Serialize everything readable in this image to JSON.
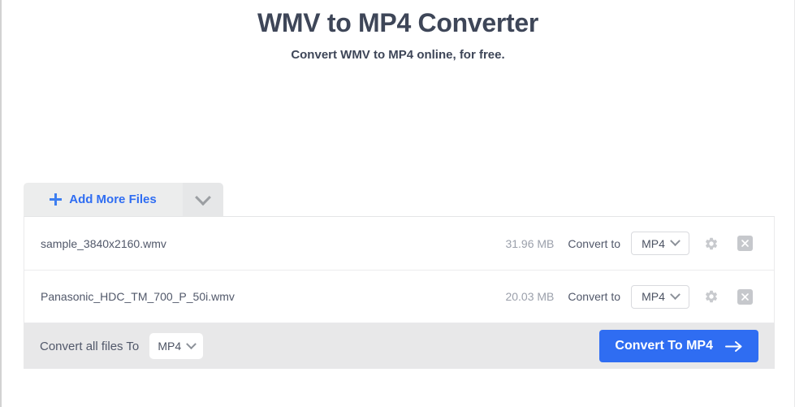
{
  "header": {
    "title": "WMV to MP4 Converter",
    "subtitle": "Convert WMV to MP4 online, for free."
  },
  "toolbar": {
    "add_files_label": "Add More Files",
    "plus_icon": "plus-icon",
    "caret_icon": "chevron-down-icon"
  },
  "files": [
    {
      "name": "sample_3840x2160.wmv",
      "size": "31.96 MB",
      "convert_to_label": "Convert to",
      "format": "MP4",
      "settings_icon": "gear-icon",
      "remove_icon": "close-icon"
    },
    {
      "name": "Panasonic_HDC_TM_700_P_50i.wmv",
      "size": "20.03 MB",
      "convert_to_label": "Convert to",
      "format": "MP4",
      "settings_icon": "gear-icon",
      "remove_icon": "close-icon"
    }
  ],
  "footer": {
    "convert_all_label": "Convert all files To",
    "convert_all_format": "MP4",
    "convert_button_label": "Convert To MP4",
    "convert_button_icon": "arrow-right-icon"
  },
  "colors": {
    "accent_blue": "#2f6df2",
    "title_text": "#3e4658",
    "body_text": "#51586a",
    "muted_text": "#9ba0ab",
    "toolbar_bg": "#eceded",
    "footer_bg": "#e8e8e9"
  }
}
